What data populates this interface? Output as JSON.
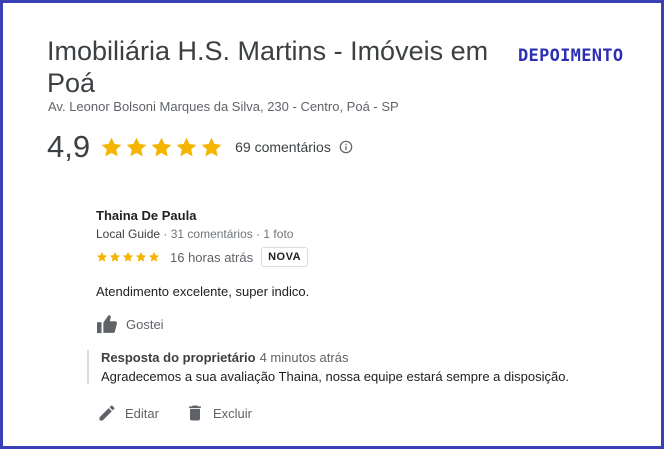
{
  "business": {
    "title": "Imobiliária H.S. Martins - Imóveis em Poá",
    "address": "Av. Leonor Bolsoni Marques da Silva, 230 - Centro, Poá - SP",
    "rating": "4,9",
    "rating_stars": 5,
    "review_count": "69 comentários"
  },
  "overlay": {
    "label": "DEPOIMENTO",
    "color": "#2b2fb0"
  },
  "review": {
    "author": "Thaina De Paula",
    "author_level": "Local Guide",
    "author_stats": "· 31 comentários · 1 foto",
    "stars": 5,
    "time": "16 horas atrás",
    "badge": "NOVA",
    "text": "Atendimento excelente, super indico.",
    "like_label": "Gostei"
  },
  "owner_response": {
    "title": "Resposta do proprietário",
    "time": "4 minutos atrás",
    "text": "Agradecemos a sua avaliação Thaina, nossa equipe estará sempre a disposição."
  },
  "actions": {
    "edit_label": "Editar",
    "delete_label": "Excluir"
  },
  "colors": {
    "star": "#f4b400",
    "frame": "#3a3fb5"
  }
}
